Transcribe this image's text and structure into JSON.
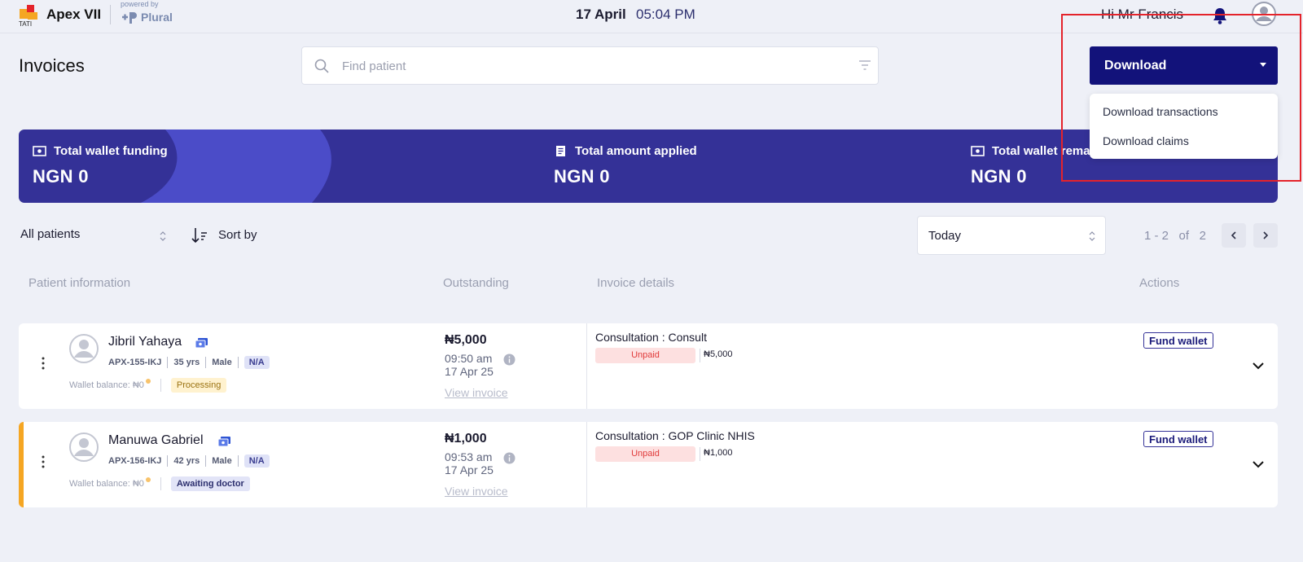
{
  "header": {
    "app_name": "Apex VII",
    "powered_by": "powered by",
    "partner": "Plural",
    "date": "17 April",
    "time": "05:04 PM",
    "greeting": "Hi Mr Francis"
  },
  "page": {
    "title": "Invoices",
    "search_placeholder": "Find patient"
  },
  "download": {
    "label": "Download",
    "menu": [
      "Download transactions",
      "Download claims"
    ]
  },
  "summary": [
    {
      "label": "Total wallet funding",
      "value": "NGN 0",
      "icon": "cash-icon"
    },
    {
      "label": "Total amount applied",
      "value": "NGN 0",
      "icon": "receipt-icon"
    },
    {
      "label": "Total wallet rema",
      "value": "NGN 0",
      "icon": "cash-icon"
    }
  ],
  "filters": {
    "patients": "All patients",
    "sort_label": "Sort by",
    "date_range": "Today",
    "pager": {
      "range": "1 - 2",
      "of": "of",
      "total": "2"
    }
  },
  "columns": [
    "Patient information",
    "Outstanding",
    "Invoice details",
    "Actions"
  ],
  "rows": [
    {
      "name": "Jibril Yahaya",
      "id": "APX-155-IKJ",
      "age": "35 yrs",
      "gender": "Male",
      "tag": "N/A",
      "wallet": "Wallet balance: ₦0",
      "status": "Processing",
      "outstanding": "₦5,000",
      "time": "09:50 am",
      "date": "17 Apr 25",
      "view_invoice": "View invoice",
      "service": "Consultation : Consult",
      "payment_status": "Unpaid",
      "service_amount": "₦5,000",
      "action": "Fund wallet"
    },
    {
      "name": "Manuwa Gabriel",
      "id": "APX-156-IKJ",
      "age": "42 yrs",
      "gender": "Male",
      "tag": "N/A",
      "wallet": "Wallet balance: ₦0",
      "status": "Awaiting doctor",
      "outstanding": "₦1,000",
      "time": "09:53 am",
      "date": "17 Apr 25",
      "view_invoice": "View invoice",
      "service": "Consultation : GOP Clinic NHIS",
      "payment_status": "Unpaid",
      "service_amount": "₦1,000",
      "action": "Fund wallet"
    }
  ],
  "colors": {
    "primary": "#12127a",
    "banner": "#343197",
    "accent_row": "#f5a623",
    "unpaid_bg": "#fde0e0",
    "unpaid_text": "#e03b3b",
    "highlight": "#e4232b"
  }
}
